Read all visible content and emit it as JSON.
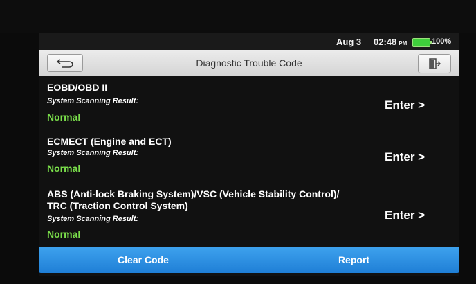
{
  "status": {
    "date": "Aug 3",
    "time": "02:48",
    "ampm": "PM",
    "battery": "100%"
  },
  "header": {
    "title": "Diagnostic Trouble Code",
    "back_icon": "back-arrow-icon",
    "exit_icon": "exit-door-icon"
  },
  "systems": [
    {
      "name": "EOBD/OBD II",
      "result_label": "System Scanning Result:",
      "status": "Normal",
      "action": "Enter >"
    },
    {
      "name": "ECMECT (Engine and ECT)",
      "result_label": "System Scanning Result:",
      "status": "Normal",
      "action": "Enter >"
    },
    {
      "name": "ABS (Anti-lock Braking System)/VSC (Vehicle Stability Control)/",
      "name_line2": "TRC (Traction Control System)",
      "result_label": "System Scanning Result:",
      "status": "Normal",
      "action": "Enter >"
    }
  ],
  "footer": {
    "clear_label": "Clear Code",
    "report_label": "Report"
  },
  "colors": {
    "status_normal": "#7be04b",
    "button_blue": "#2a8fe0"
  }
}
